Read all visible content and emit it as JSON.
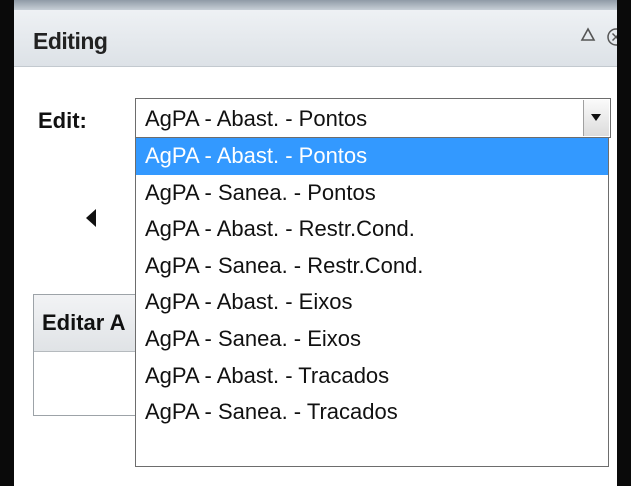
{
  "window": {
    "title": "Editing"
  },
  "edit": {
    "label": "Edit:",
    "selected_value": "AgPA - Abast. - Pontos"
  },
  "dropdown": {
    "options": [
      {
        "label": "AgPA - Abast. - Pontos",
        "selected": true
      },
      {
        "label": "AgPA - Sanea. - Pontos",
        "selected": false
      },
      {
        "label": "AgPA - Abast. - Restr.Cond.",
        "selected": false
      },
      {
        "label": "AgPA - Sanea. - Restr.Cond.",
        "selected": false
      },
      {
        "label": "AgPA - Abast. - Eixos",
        "selected": false
      },
      {
        "label": "AgPA - Sanea. - Eixos",
        "selected": false
      },
      {
        "label": "AgPA - Abast. - Tracados",
        "selected": false
      },
      {
        "label": "AgPA - Sanea. - Tracados",
        "selected": false
      }
    ]
  },
  "section": {
    "title": "Editar A"
  },
  "colors": {
    "selection_highlight": "#3399ff",
    "link": "#2b5fb8"
  },
  "icons": {
    "collapse": "collapse-triangle-icon",
    "close": "close-circle-icon",
    "dropdown": "chevron-down-icon",
    "navigate": "left-arrow-icon"
  }
}
